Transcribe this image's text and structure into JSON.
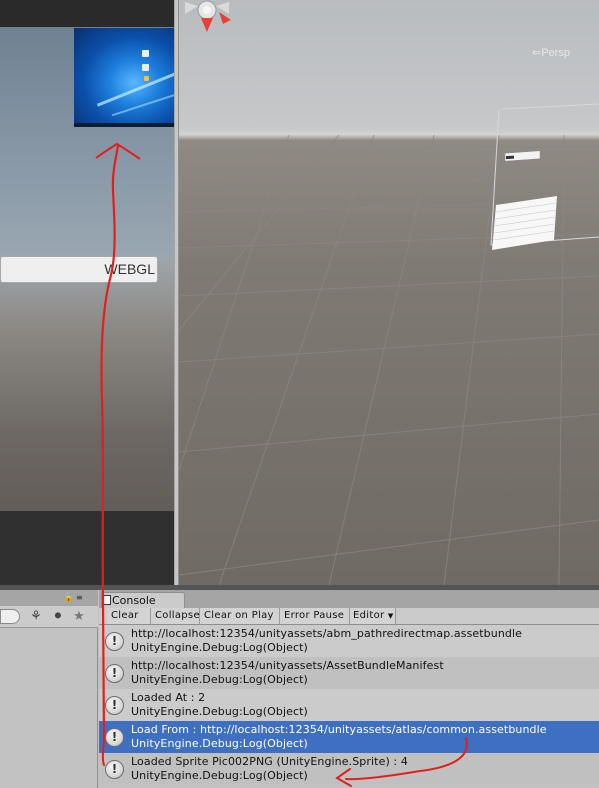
{
  "game_view": {
    "webgl_field_value": "WEBGL"
  },
  "scene_view": {
    "projection_label": "Persp"
  },
  "console": {
    "tab_label": "Console",
    "toolbar": {
      "clear": "Clear",
      "collapse": "Collapse",
      "clear_on_play": "Clear on Play",
      "error_pause": "Error Pause",
      "editor": "Editor"
    },
    "logs": [
      {
        "line1": "http://localhost:12354/unityassets/abm_pathredirectmap.assetbundle",
        "line2": "UnityEngine.Debug:Log(Object)"
      },
      {
        "line1": "http://localhost:12354/unityassets/AssetBundleManifest",
        "line2": "UnityEngine.Debug:Log(Object)"
      },
      {
        "line1": "Loaded At : 2",
        "line2": "UnityEngine.Debug:Log(Object)"
      },
      {
        "line1": "Load From : http://localhost:12354/unityassets/atlas/common.assetbundle",
        "line2": "UnityEngine.Debug:Log(Object)"
      },
      {
        "line1": "Loaded Sprite Pic002PNG (UnityEngine.Sprite) : 4",
        "line2": "UnityEngine.Debug:Log(Object)"
      }
    ],
    "selected_index": 3,
    "log_icon": "info-icon"
  },
  "colors": {
    "selection": "#3e6fc1",
    "annotation": "#e0201c"
  }
}
